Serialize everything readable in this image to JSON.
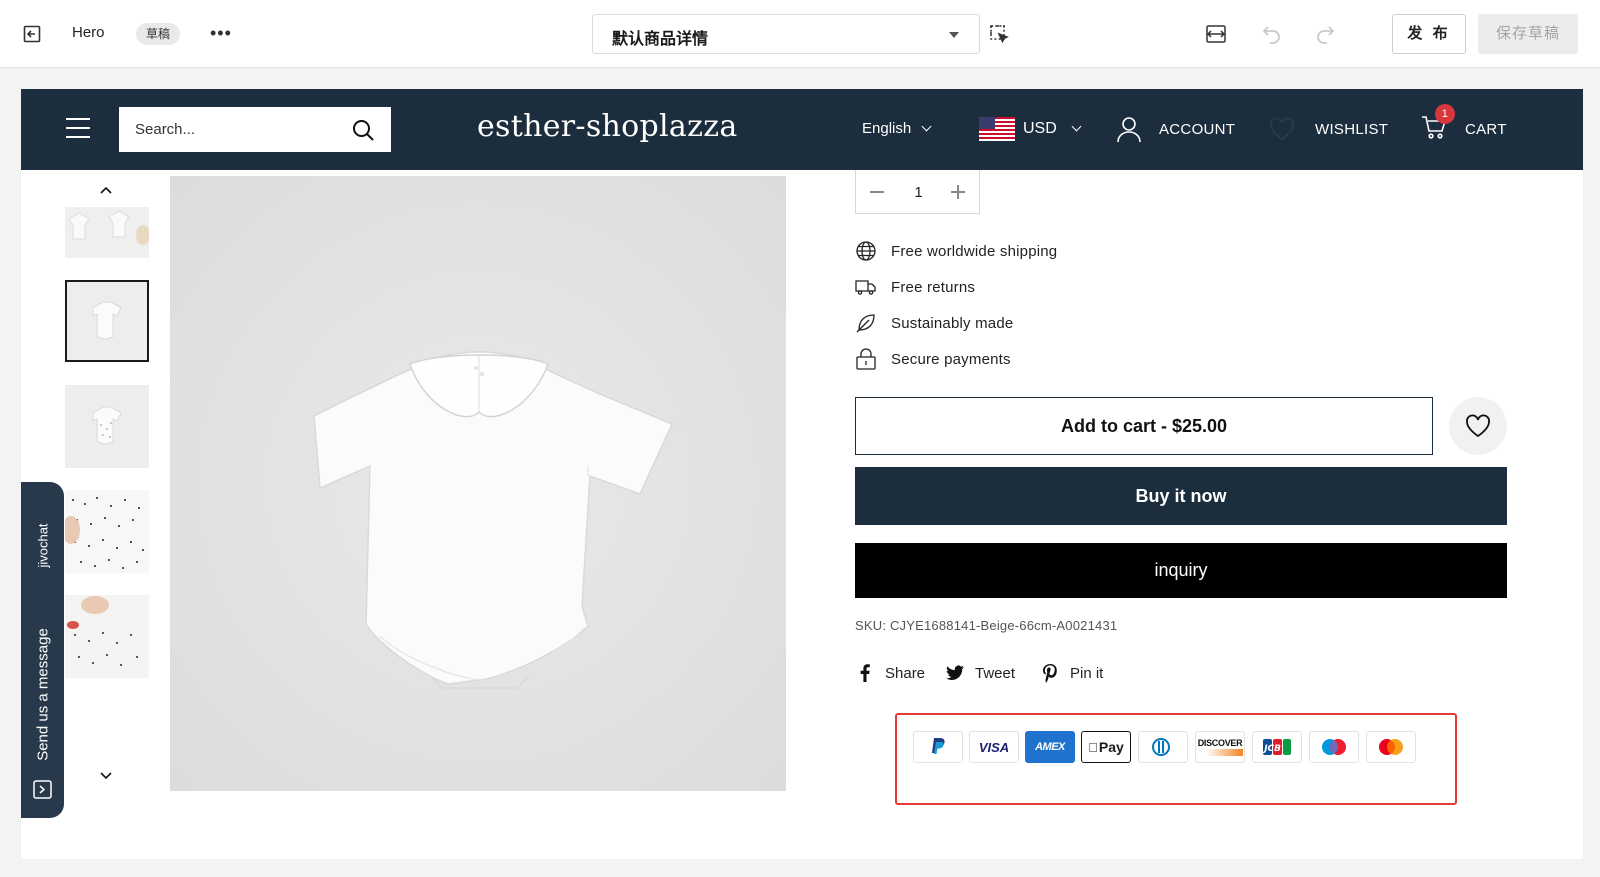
{
  "editor": {
    "page_name": "Hero",
    "status_badge": "草稿",
    "more_label": "•••",
    "template_select": "默认商品详情",
    "publish_label": "发 布",
    "save_draft_label": "保存草稿"
  },
  "store_header": {
    "search_placeholder": "Search...",
    "logo": "esther-shoplazza",
    "language": "English",
    "currency": "USD",
    "account_label": "ACCOUNT",
    "wishlist_label": "WISHLIST",
    "cart_label": "CART",
    "cart_count": "1"
  },
  "chat_widget": {
    "brand": "jivochat",
    "message": "Send us a message"
  },
  "product": {
    "quantity": "1",
    "features": [
      {
        "icon": "globe-icon",
        "label": "Free worldwide shipping"
      },
      {
        "icon": "truck-icon",
        "label": "Free returns"
      },
      {
        "icon": "leaf-icon",
        "label": "Sustainably made"
      },
      {
        "icon": "lock-icon",
        "label": "Secure payments"
      }
    ],
    "add_to_cart": "Add to cart - $25.00",
    "buy_now": "Buy it now",
    "inquiry": "inquiry",
    "sku": "SKU: CJYE1688141-Beige-66cm-A0021431",
    "share": [
      {
        "icon": "facebook-icon",
        "label": "Share"
      },
      {
        "icon": "twitter-icon",
        "label": "Tweet"
      },
      {
        "icon": "pinterest-icon",
        "label": "Pin it"
      }
    ],
    "payment_methods": [
      "PayPal",
      "VISA",
      "AMEX",
      "Apple Pay",
      "Diners Club",
      "DISCOVER",
      "JCB",
      "Maestro",
      "Mastercard"
    ],
    "payment_labels": {
      "visa": "VISA",
      "amex": "AMEX",
      "applepay": "Pay",
      "discover": "DISCOVER",
      "jcb": "JCB"
    }
  },
  "colors": {
    "header_bg": "#1c2d3e",
    "buy_now_bg": "#1c2d3e",
    "inquiry_bg": "#000000",
    "highlight_border": "#e53935",
    "cart_badge": "#d9363e"
  }
}
